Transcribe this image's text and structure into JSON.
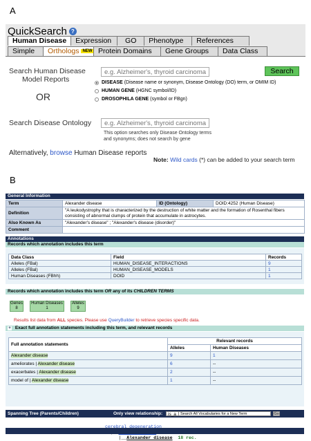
{
  "panel_labels": {
    "a": "A",
    "b": "B"
  },
  "quicksearch": {
    "title": "QuickSearch",
    "main_tabs": [
      "Human Disease",
      "Expression",
      "GO",
      "Phenotype",
      "References"
    ],
    "sub_tabs": [
      "Simple",
      "Orthologs",
      "Protein Domains",
      "Gene Groups",
      "Data Class"
    ],
    "new_badge": "NEW",
    "search_reports_label_1": "Search Human Disease",
    "search_reports_label_2": "Model Reports",
    "search_placeholder": "e.g. Alzheimer's, thyroid carcinoma",
    "search_button": "Search",
    "radio_disease_strong": "DISEASE",
    "radio_disease_rest": "(Disease name or synonym, Disease Ontology (DO) term, or OMIM ID)",
    "radio_gene_strong": "HUMAN GENE",
    "radio_gene_rest": "(HGNC symbol/ID)",
    "radio_dros_strong": "DROSOPHILA GENE",
    "radio_dros_rest": "(symbol or FBgn)",
    "or_text": "OR",
    "ontology_label": "Search Disease Ontology",
    "ontology_placeholder": "e.g. Alzheimer's, thyroid carcinoma",
    "ontology_note_1": "This option searches only Disease Ontology terms",
    "ontology_note_2": "and synonyms; does not search by gene",
    "alt_prefix": "Alternatively,",
    "alt_link": "browse",
    "alt_suffix": "Human Disease reports",
    "note_strong": "Note:",
    "note_link": "Wild cards",
    "note_rest": "(*) can be added to your search term"
  },
  "report": {
    "general_header": "General Information",
    "term_label": "Term",
    "term_value": "Alexander disease",
    "id_label": "ID (Ontology)",
    "id_value": "DOID:4252 (Human Disease)",
    "definition_label": "Definition",
    "definition_value": "\"A leukodystrophy that is characterized by the destruction of white matter and the formation of Rosenthal fibers consisting of abnormal clumps of protein that accumulate in astrocytes.",
    "aka_label": "Also Known As",
    "aka_value": "\"Alexander's disease\" ; \"Alexander's disease (disorder)\"",
    "comment_label": "Comment",
    "annotations_header": "Annotations",
    "records_header": "Records which annotation includes this term",
    "records_columns": [
      "Data Class",
      "Field",
      "Records"
    ],
    "records_rows": [
      [
        "Alleles (FBal)",
        "HUMAN_DISEASE_INTERACTIONS",
        "9"
      ],
      [
        "Alleles (FBal)",
        "HUMAN_DISEASE_MODELS",
        "1"
      ],
      [
        "Human Diseases (FBhh)",
        "DOID",
        "1"
      ]
    ],
    "children_header_pre": "Records which annotation includes this term",
    "children_header_or": "OR",
    "children_header_post": "any of its",
    "children_header_em": "CHILDREN TERMS",
    "chips": [
      {
        "label": "Genes",
        "count": "8"
      },
      {
        "label": "Human Diseases",
        "count": "1"
      },
      {
        "label": "Alleles",
        "count": "9"
      }
    ],
    "species_note_pre": "Results list data from",
    "species_note_all": "ALL",
    "species_note_mid": "species. Please use",
    "species_note_link": "QueryBuilder",
    "species_note_post": "to retrieve species specific data.",
    "exact_header": "Exact full annotation statements including this term, and relevant records",
    "full_annot_label": "Full annotation statements",
    "relevant_label": "Relevant records",
    "col_alleles": "Alleles",
    "col_human": "Human Diseases",
    "annot_rows": [
      {
        "pre": "",
        "term": "Alexander disease",
        "alleles": "9",
        "human": "1"
      },
      {
        "pre": "ameliorates |",
        "term": "Alexander disease",
        "alleles": "6",
        "human": "--"
      },
      {
        "pre": "exacerbates |",
        "term": "Alexander disease",
        "alleles": "2",
        "human": "--"
      },
      {
        "pre": "model of |",
        "term": "Alexander disease",
        "alleles": "1",
        "human": "--"
      }
    ],
    "spanning_label": "Spanning Tree (Parents/Children)",
    "only_view_label": "Only view relationship:",
    "relationship_value": "is_a",
    "vocab_search_placeholder": "Search All Vocabularies for a New Term",
    "go_button": "Go",
    "tree_parent": "cerebral degeneration",
    "tree_child": "leukodystrophy",
    "tree_term": "Alexander disease",
    "tree_count": "18 rec."
  },
  "colors": {
    "navy": "#1c2e55",
    "green": "#5ec45a",
    "link": "#2b56c7"
  }
}
